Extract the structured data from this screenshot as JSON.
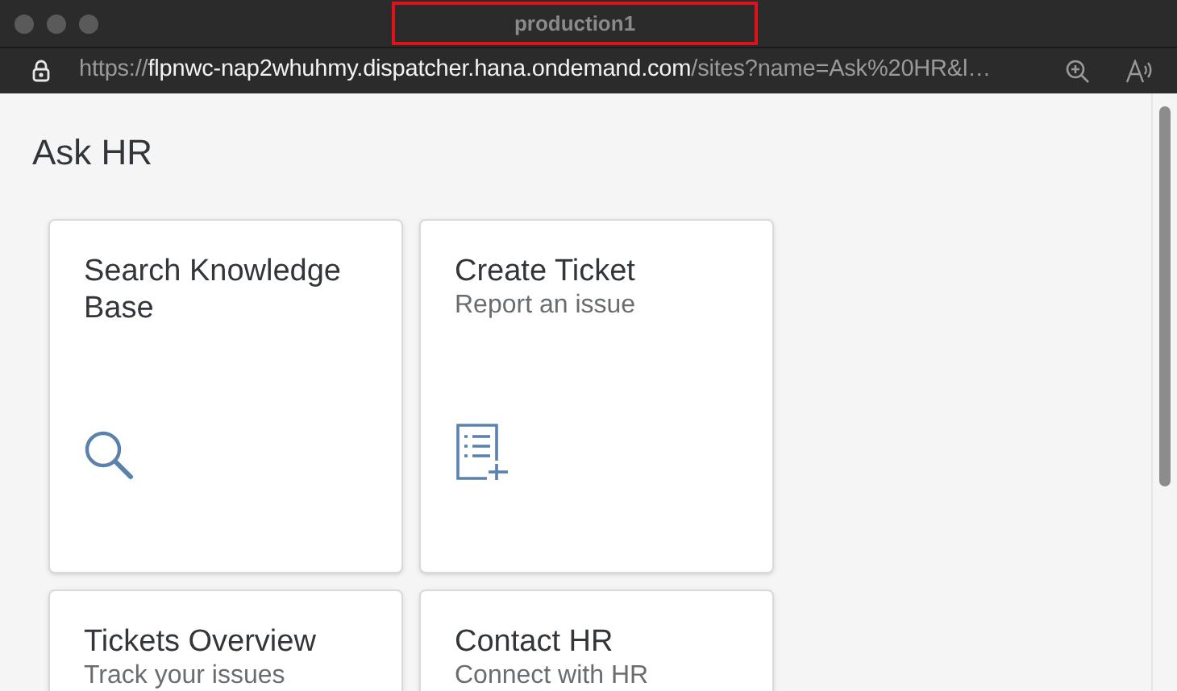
{
  "window": {
    "title": "production1",
    "title_highlighted": true
  },
  "address_bar": {
    "scheme": "https://",
    "host": "flpnwc-nap2whuhmy.dispatcher.hana.ondemand.com",
    "path": "/sites?name=Ask%20HR&l…"
  },
  "page": {
    "title": "Ask HR"
  },
  "tiles": [
    {
      "title": "Search Knowledge Base",
      "kind": "search"
    },
    {
      "title": "Create Ticket",
      "subtitle": "Report an issue",
      "kind": "create"
    },
    {
      "title": "Tickets Overview",
      "subtitle": "Track your issues"
    },
    {
      "title": "Contact HR",
      "subtitle": "Connect with HR"
    }
  ]
}
